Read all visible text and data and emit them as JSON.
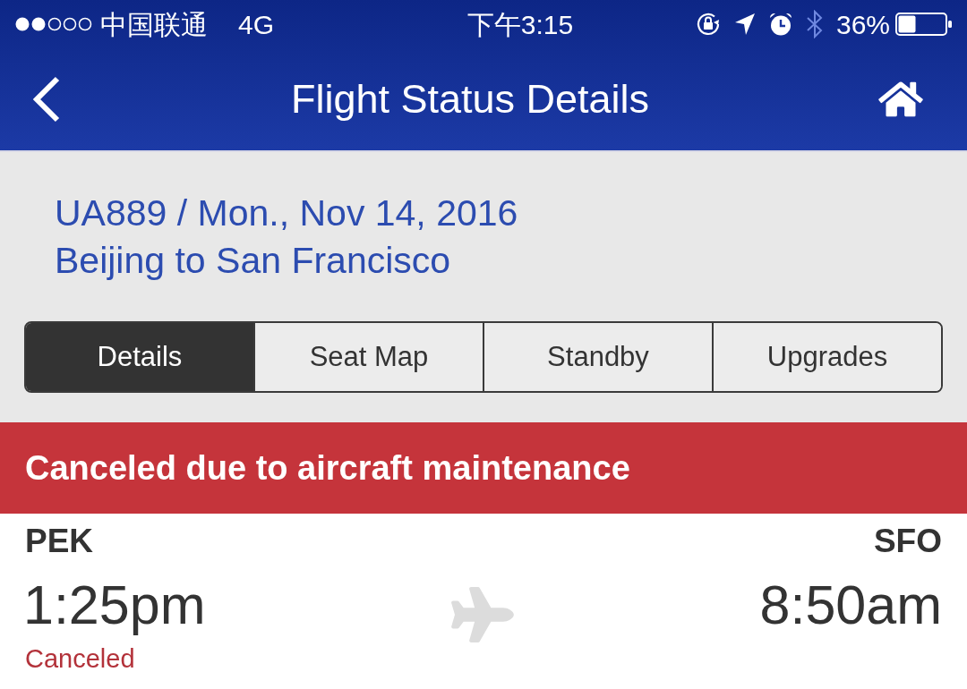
{
  "status_bar": {
    "carrier": "中国联通",
    "network": "4G",
    "time": "下午3:15",
    "battery": "36%"
  },
  "nav_bar": {
    "title": "Flight Status Details"
  },
  "flight": {
    "summary": "UA889 / Mon., Nov 14, 2016",
    "route": "Beijing to San Francisco"
  },
  "tabs": [
    {
      "label": "Details",
      "selected": true
    },
    {
      "label": "Seat Map",
      "selected": false
    },
    {
      "label": "Standby",
      "selected": false
    },
    {
      "label": "Upgrades",
      "selected": false
    }
  ],
  "alert": {
    "message": "Canceled due to aircraft maintenance"
  },
  "departure": {
    "airport": "PEK",
    "time": "1:25pm",
    "status": "Canceled"
  },
  "arrival": {
    "airport": "SFO",
    "time": "8:50am"
  }
}
